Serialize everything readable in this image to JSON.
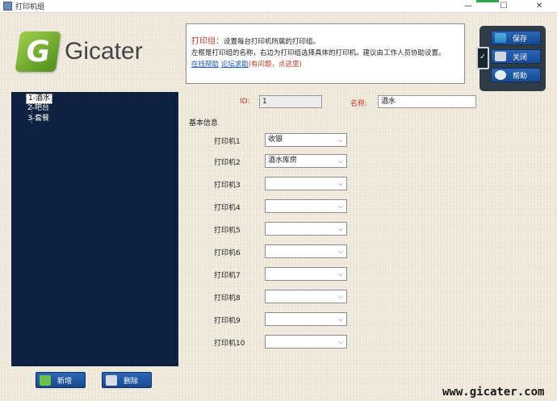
{
  "window": {
    "title": "打印机组",
    "buttons": {
      "minimize": "—",
      "maximize": "☐",
      "close": "✕"
    }
  },
  "logo": {
    "mark": "G",
    "text": "Gicater"
  },
  "tree": {
    "items": [
      {
        "label": "1-酒水",
        "selected": true
      },
      {
        "label": "2-吧台",
        "selected": false
      },
      {
        "label": "3-套餐",
        "selected": false
      }
    ]
  },
  "help": {
    "title": "打印组：",
    "line1": "设置每台打印机所属的打印组。",
    "line2": "左框是打印组的名称，右边为打印组选择具体的打印机。建议由工作人员协助设置。",
    "link1": "在线帮助",
    "link2": "论坛求助",
    "red_note": "(有问题，点这里)"
  },
  "side_buttons": {
    "save": "保存",
    "close": "关闭",
    "help": "帮助"
  },
  "form": {
    "id_label": "ID:",
    "id_value": "1",
    "name_label": "名称:",
    "name_value": "酒水",
    "section_label": "基本信息",
    "printers": [
      {
        "label": "打印机1",
        "value": "收银"
      },
      {
        "label": "打印机2",
        "value": "酒水库房"
      },
      {
        "label": "打印机3",
        "value": ""
      },
      {
        "label": "打印机4",
        "value": ""
      },
      {
        "label": "打印机5",
        "value": ""
      },
      {
        "label": "打印机6",
        "value": ""
      },
      {
        "label": "打印机7",
        "value": ""
      },
      {
        "label": "打印机8",
        "value": ""
      },
      {
        "label": "打印机9",
        "value": ""
      },
      {
        "label": "打印机10",
        "value": ""
      }
    ]
  },
  "bottom_buttons": {
    "add": "新增",
    "delete": "删除"
  },
  "watermark": "www.gicater.com"
}
